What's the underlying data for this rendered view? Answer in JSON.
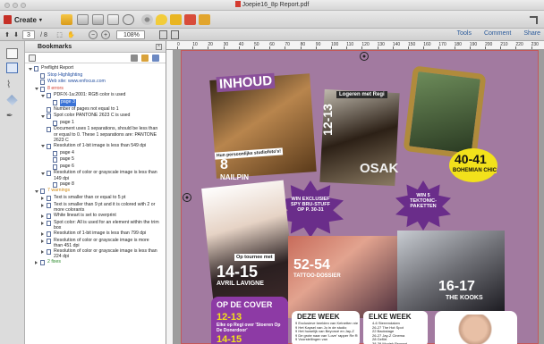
{
  "window": {
    "title": "Joepie16_8p Report.pdf"
  },
  "toolbar": {
    "create_label": "Create",
    "page_current": "3",
    "page_total": "/ 8",
    "zoom": "108%",
    "links": [
      "Tools",
      "Comment",
      "Share"
    ]
  },
  "bookmarks": {
    "panel_title": "Bookmarks",
    "items": [
      {
        "label": "Preflight Report",
        "indent": 0,
        "icon": "doc",
        "expand": "down",
        "color": ""
      },
      {
        "label": "Stop Highlighting",
        "indent": 1,
        "icon": "page",
        "expand": "",
        "color": "blue"
      },
      {
        "label": "Web site: www.enfocus.com",
        "indent": 1,
        "icon": "page",
        "expand": "",
        "color": "blue"
      },
      {
        "label": "8 errors",
        "indent": 1,
        "icon": "page",
        "expand": "down",
        "color": "red"
      },
      {
        "label": "PDF/X-1a:2001: RGB color is used",
        "indent": 2,
        "icon": "page",
        "expand": "down",
        "color": ""
      },
      {
        "label": "page 3",
        "indent": 3,
        "icon": "page",
        "expand": "",
        "color": "",
        "selected": true
      },
      {
        "label": "Number of pages not equal to 1",
        "indent": 2,
        "icon": "page",
        "expand": "",
        "color": ""
      },
      {
        "label": "Spot color PANTONE 2623 C is used",
        "indent": 2,
        "icon": "page",
        "expand": "down",
        "color": ""
      },
      {
        "label": "page 1",
        "indent": 3,
        "icon": "page",
        "expand": "",
        "color": ""
      },
      {
        "label": "Document uses 1 separations, should be less than or equal to 0. These 1 separations are: PANTONE 2623 C",
        "indent": 2,
        "icon": "page",
        "expand": "",
        "color": "",
        "wrap": true
      },
      {
        "label": "Resolution of 1-bit image is less than 549 dpi",
        "indent": 2,
        "icon": "page",
        "expand": "down",
        "color": ""
      },
      {
        "label": "page 4",
        "indent": 3,
        "icon": "page",
        "expand": "",
        "color": ""
      },
      {
        "label": "page 5",
        "indent": 3,
        "icon": "page",
        "expand": "",
        "color": ""
      },
      {
        "label": "page 6",
        "indent": 3,
        "icon": "page",
        "expand": "",
        "color": ""
      },
      {
        "label": "Resolution of color or grayscale image is less than 149 dpi",
        "indent": 2,
        "icon": "page",
        "expand": "down",
        "color": "",
        "wrap": true
      },
      {
        "label": "page 8",
        "indent": 3,
        "icon": "page",
        "expand": "",
        "color": ""
      },
      {
        "label": "7 warnings",
        "indent": 1,
        "icon": "page",
        "expand": "down",
        "color": "orange"
      },
      {
        "label": "Text is smaller than or equal to 5 pt",
        "indent": 2,
        "icon": "page",
        "expand": "right",
        "color": ""
      },
      {
        "label": "Text is smaller than 9 pt and it is colored with 2 or more colorants",
        "indent": 2,
        "icon": "page",
        "expand": "right",
        "color": "",
        "wrap": true
      },
      {
        "label": "White lineart is set to overprint",
        "indent": 2,
        "icon": "page",
        "expand": "right",
        "color": ""
      },
      {
        "label": "Spot color: All is used for an element within the trim box",
        "indent": 2,
        "icon": "page",
        "expand": "right",
        "color": "",
        "wrap": true
      },
      {
        "label": "Resolution of 1-bit image is less than 799 dpi",
        "indent": 2,
        "icon": "page",
        "expand": "right",
        "color": ""
      },
      {
        "label": "Resolution of color or grayscale image is more than 451 dpi",
        "indent": 2,
        "icon": "page",
        "expand": "right",
        "color": "",
        "wrap": true
      },
      {
        "label": "Resolution of color or grayscale image is less than 224 dpi",
        "indent": 2,
        "icon": "page",
        "expand": "right",
        "color": "",
        "wrap": true
      },
      {
        "label": "2 fixes",
        "indent": 1,
        "icon": "page",
        "expand": "right",
        "color": "green"
      }
    ]
  },
  "ruler": {
    "marks": [
      "0",
      "10",
      "20",
      "30",
      "40",
      "50",
      "60",
      "70",
      "80",
      "90",
      "100",
      "110",
      "120",
      "130",
      "140",
      "150",
      "160",
      "170",
      "180",
      "190",
      "200",
      "210",
      "220",
      "230"
    ]
  },
  "page": {
    "inhoud": "INHOUD",
    "caption_left": "Hun persoonlijke studiofoto's!",
    "num_8": "8",
    "nailpin": "NAILPIN",
    "num_1213": "12-13",
    "logeren": "Logeren met Regi",
    "osak": "OSAK",
    "num_4041": "40-41",
    "bohemian": "BOHEMIAN CHIC",
    "win_left": "WIN EXCLUSIEF SPY BRU-STUFF OP P. 30-31",
    "win_right": "WIN 5 TEKTONIC-PAKETTEN",
    "toutmee": "Op tournee met",
    "num_1415": "14-15",
    "avril": "AVRIL LAVIGNE",
    "num_5254": "52-54",
    "tattoo": "TATTOO-DOSSIER",
    "num_1617": "16-17",
    "kooks": "THE KOOKS",
    "opdecover": "OP DE COVER",
    "cover_1213": "12-13",
    "cover_text": "Elke op Regi over 'Stoeren Op De Donerdoor'",
    "cover_1415": "14-15",
    "deze_week": "DEZE WEEK",
    "elke_week": "ELKE WEEK",
    "deze_items": [
      "9 Exclusieve beelden van Ketnetten nieuwste clip",
      "9 Het Kapsel van Jo in de studio",
      "9 Het huwelijk van Beyoncé en Jay-Z",
      "9 De grote naar van 'Love' rapper Re Rida",
      "9 Voorstellingen van"
    ],
    "elke_items": [
      "4-6 Sterrendaken",
      "26-27 The Hot Spot",
      "22 Backstage",
      "26-27 Jay-Z Cinema",
      "28 Geflirt",
      "38-39 Muziek Prosent",
      "39 Puzzel"
    ]
  }
}
